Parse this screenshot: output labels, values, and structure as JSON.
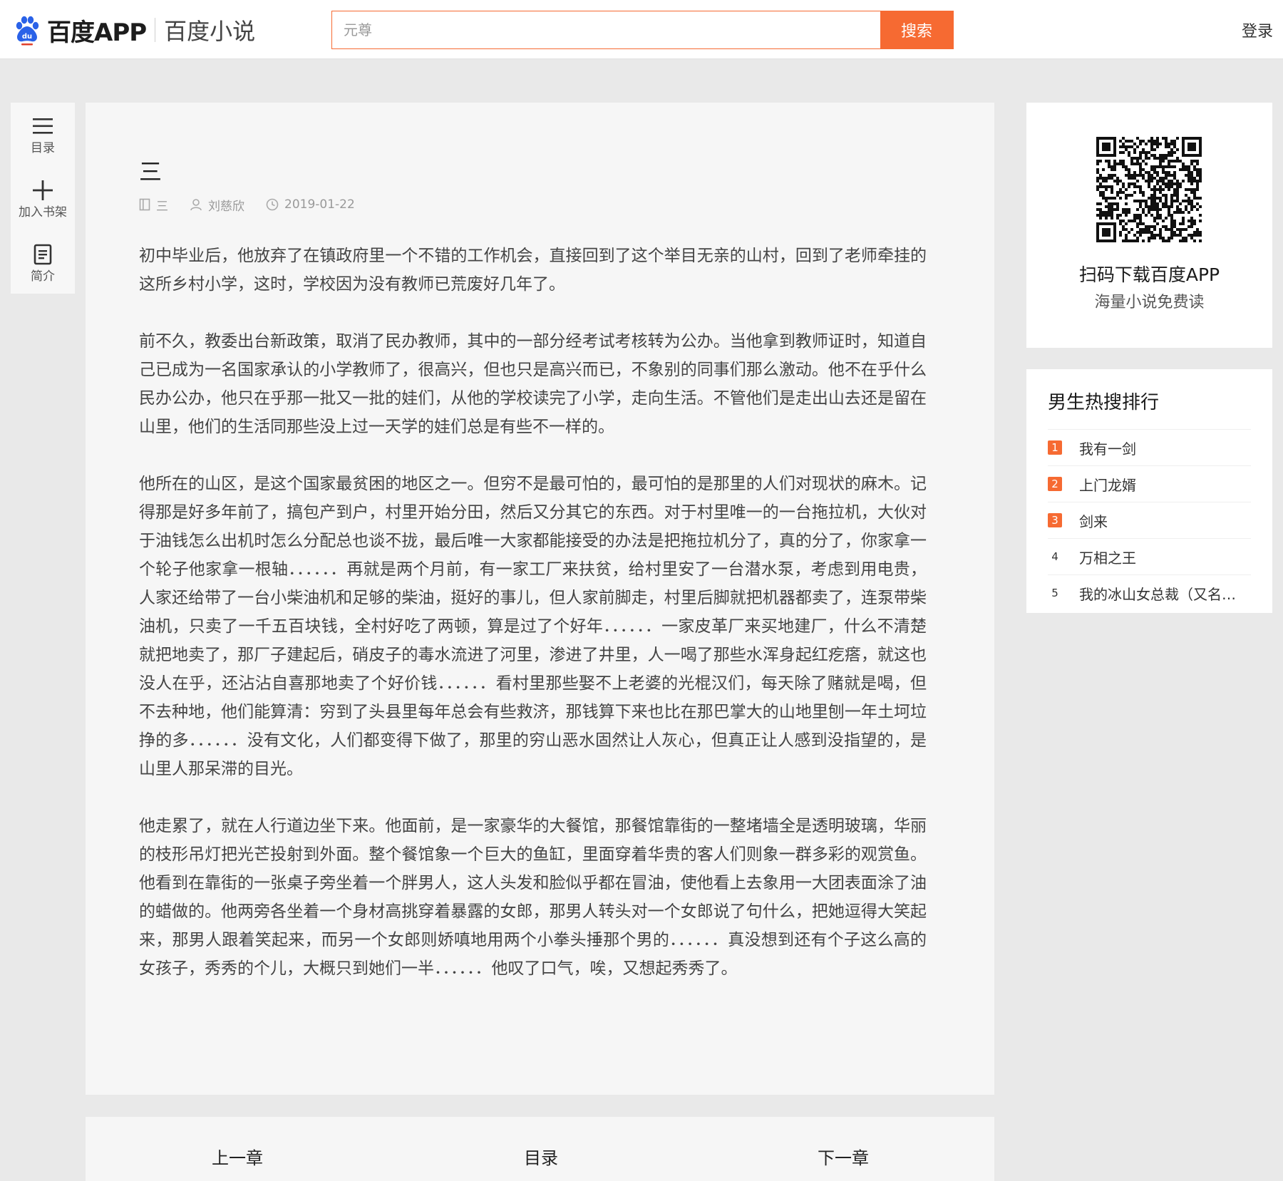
{
  "header": {
    "brand": "百度APP",
    "site_name": "百度小说",
    "search_placeholder": "元尊",
    "search_button": "搜索",
    "login": "登录",
    "accent_color": "#f66a32"
  },
  "toolbar": {
    "items": [
      {
        "label": "目录",
        "icon": "menu-icon"
      },
      {
        "label": "加入书架",
        "icon": "plus-icon"
      },
      {
        "label": "简介",
        "icon": "document-icon"
      }
    ]
  },
  "chapter": {
    "title": "三",
    "book": "三",
    "author": "刘慈欣",
    "date": "2019-01-22",
    "paragraphs": [
      "初中毕业后，他放弃了在镇政府里一个不错的工作机会，直接回到了这个举目无亲的山村，回到了老师牵挂的这所乡村小学，这时，学校因为没有教师已荒废好几年了。",
      "前不久，教委出台新政策，取消了民办教师，其中的一部分经考试考核转为公办。当他拿到教师证时，知道自己已成为一名国家承认的小学教师了，很高兴，但也只是高兴而已，不象别的同事们那么激动。他不在乎什么民办公办，他只在乎那一批又一批的娃们，从他的学校读完了小学，走向生活。不管他们是走出山去还是留在山里，他们的生活同那些没上过一天学的娃们总是有些不一样的。",
      "他所在的山区，是这个国家最贫困的地区之一。但穷不是最可怕的，最可怕的是那里的人们对现状的麻木。记得那是好多年前了，搞包产到户，村里开始分田，然后又分其它的东西。对于村里唯一的一台拖拉机，大伙对于油钱怎么出机时怎么分配总也谈不拢，最后唯一大家都能接受的办法是把拖拉机分了，真的分了，你家拿一个轮子他家拿一根轴．．．．．．再就是两个月前，有一家工厂来扶贫，给村里安了一台潜水泵，考虑到用电贵，人家还给带了一台小柴油机和足够的柴油，挺好的事儿，但人家前脚走，村里后脚就把机器都卖了，连泵带柴油机，只卖了一千五百块钱，全村好吃了两顿，算是过了个好年．．．．．．一家皮革厂来买地建厂，什么不清楚就把地卖了，那厂子建起后，硝皮子的毒水流进了河里，渗进了井里，人一喝了那些水浑身起红疙瘩，就这也没人在乎，还沾沾自喜那地卖了个好价钱．．．．．．看村里那些娶不上老婆的光棍汉们，每天除了赌就是喝，但不去种地，他们能算清：穷到了头县里每年总会有些救济，那钱算下来也比在那巴掌大的山地里刨一年土坷垃挣的多．．．．．．没有文化，人们都变得下做了，那里的穷山恶水固然让人灰心，但真正让人感到没指望的，是山里人那呆滞的目光。",
      "他走累了，就在人行道边坐下来。他面前，是一家豪华的大餐馆，那餐馆靠街的一整堵墙全是透明玻璃，华丽的枝形吊灯把光芒投射到外面。整个餐馆象一个巨大的鱼缸，里面穿着华贵的客人们则象一群多彩的观赏鱼。他看到在靠街的一张桌子旁坐着一个胖男人，这人头发和脸似乎都在冒油，使他看上去象用一大团表面涂了油的蜡做的。他两旁各坐着一个身材高挑穿着暴露的女郎，那男人转头对一个女郎说了句什么，把她逗得大笑起来，那男人跟着笑起来，而另一个女郎则娇嗔地用两个小拳头捶那个男的．．．．．．真没想到还有个子这么高的女孩子，秀秀的个儿，大概只到她们一半．．．．．．他叹了口气，唉，又想起秀秀了。"
    ]
  },
  "pager": {
    "prev": "上一章",
    "toc": "目录",
    "next": "下一章"
  },
  "qr": {
    "title": "扫码下载百度APP",
    "subtitle": "海量小说免费读"
  },
  "ranking": {
    "title": "男生热搜排行",
    "items": [
      {
        "rank": "1",
        "name": "我有一剑"
      },
      {
        "rank": "2",
        "name": "上门龙婿"
      },
      {
        "rank": "3",
        "name": "剑来"
      },
      {
        "rank": "4",
        "name": "万相之王"
      },
      {
        "rank": "5",
        "name": "我的冰山女总裁（又名…"
      }
    ]
  }
}
